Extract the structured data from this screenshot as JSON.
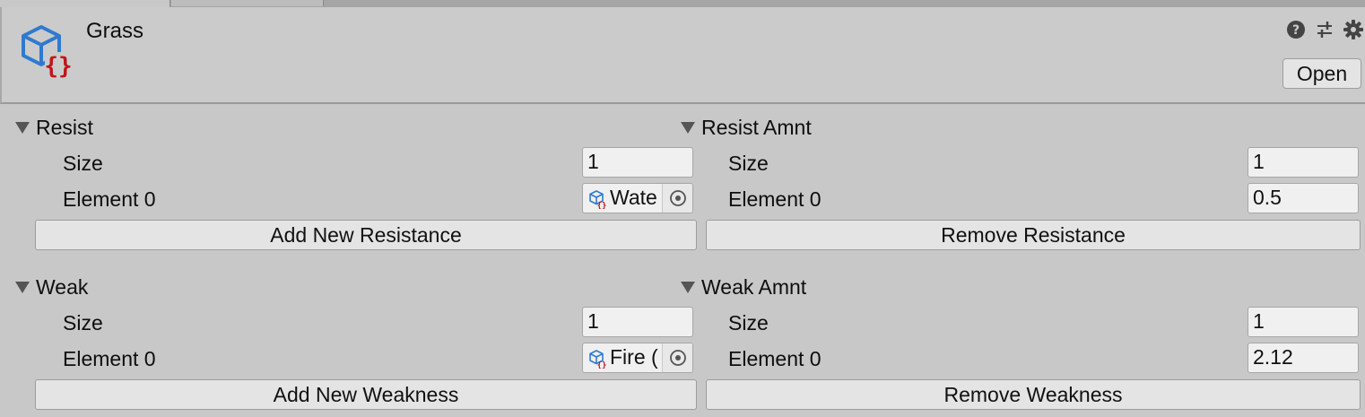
{
  "header": {
    "title": "Grass",
    "open_label": "Open",
    "icons": [
      "help-icon",
      "preset-icon",
      "settings-icon"
    ]
  },
  "resist": {
    "label": "Resist",
    "size_label": "Size",
    "size_value": "1",
    "element_label": "Element 0",
    "element_value": "Wate",
    "button_label": "Add New Resistance"
  },
  "resist_amnt": {
    "label": "Resist Amnt",
    "size_label": "Size",
    "size_value": "1",
    "element_label": "Element 0",
    "element_value": "0.5",
    "button_label": "Remove Resistance"
  },
  "weak": {
    "label": "Weak",
    "size_label": "Size",
    "size_value": "1",
    "element_label": "Element 0",
    "element_value": "Fire (",
    "button_label": "Add New Weakness"
  },
  "weak_amnt": {
    "label": "Weak Amnt",
    "size_label": "Size",
    "size_value": "1",
    "element_label": "Element 0",
    "element_value": "2.12",
    "button_label": "Remove Weakness"
  },
  "colors": {
    "background": "#c8c8c8",
    "icon_blue": "#2f7ad1",
    "icon_red": "#c0161b"
  }
}
